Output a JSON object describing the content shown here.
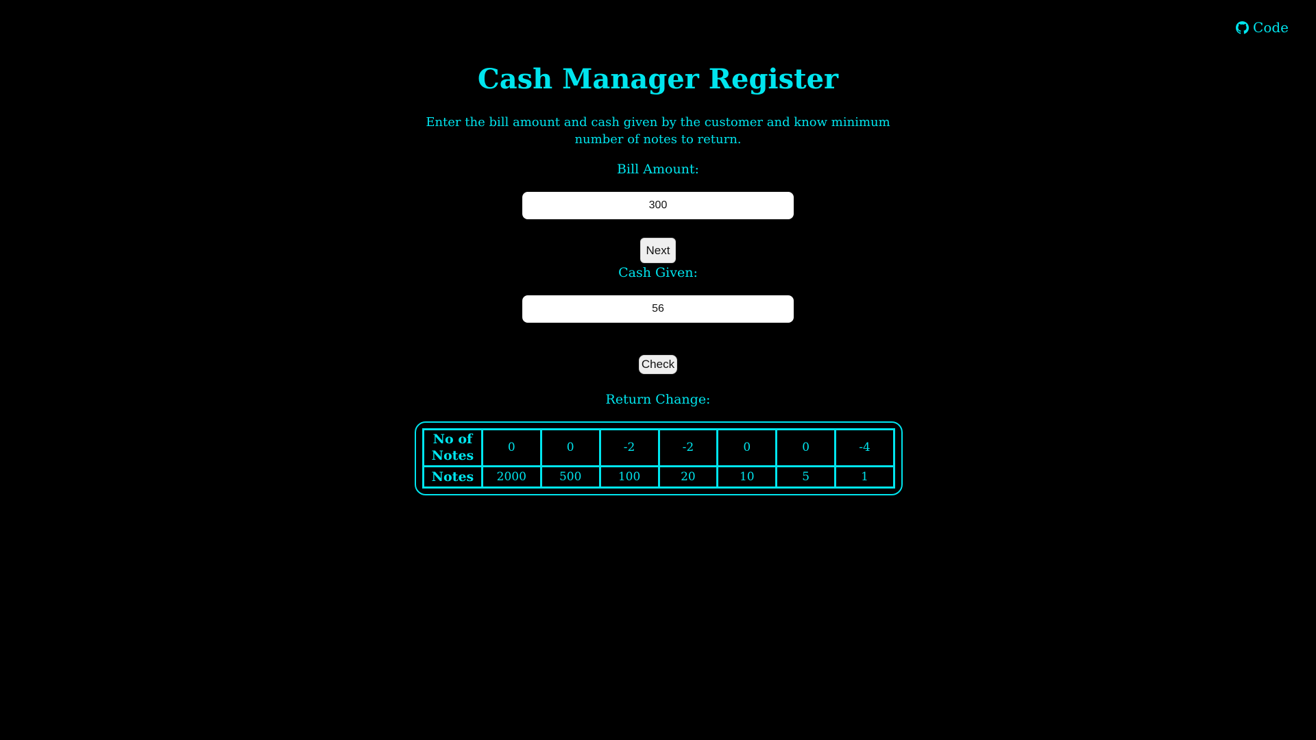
{
  "header": {
    "code_link_label": "Code",
    "code_icon": "github-icon"
  },
  "page": {
    "title": "Cash Manager Register",
    "description": "Enter the bill amount and cash given by the customer and know minimum number of notes to return."
  },
  "form": {
    "bill_label": "Bill Amount:",
    "bill_value": "300",
    "next_label": "Next",
    "cash_label": "Cash Given:",
    "cash_value": "56",
    "check_label": "Check",
    "return_label": "Return Change:"
  },
  "change_table": {
    "count_header": "No of Notes",
    "notes_header": "Notes",
    "counts": [
      "0",
      "0",
      "-2",
      "-2",
      "0",
      "0",
      "-4"
    ],
    "notes": [
      "2000",
      "500",
      "100",
      "20",
      "10",
      "5",
      "1"
    ]
  },
  "colors": {
    "accent": "#00e5ee",
    "background": "#000000",
    "input_bg": "#ffffff"
  }
}
